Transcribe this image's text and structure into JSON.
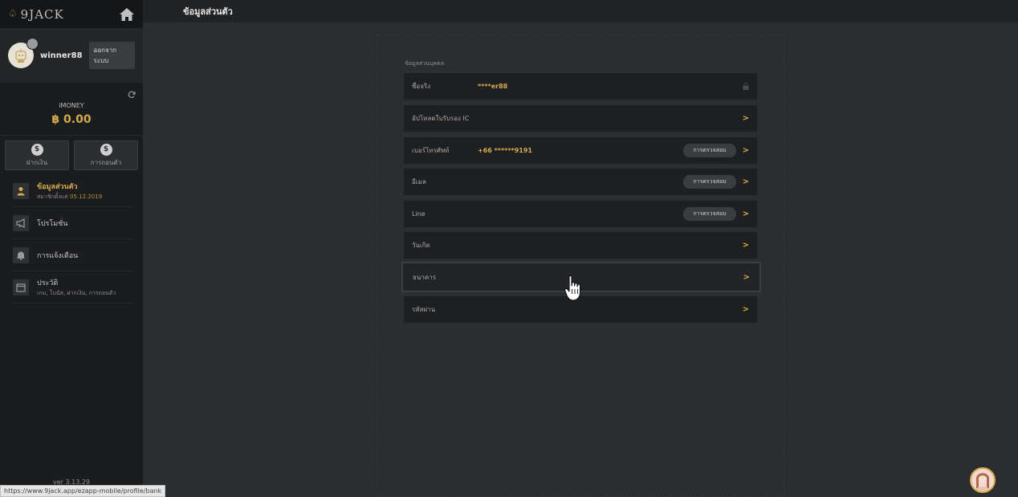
{
  "sidebar": {
    "logo_text": "9JACK",
    "username": "winner88",
    "logout_label": "ออกจากระบบ",
    "wallet_label": "iMONEY",
    "balance": "฿ 0.00",
    "deposit_label": "ฝากเงิน",
    "withdraw_label": "การถอนตัว",
    "items": [
      {
        "title": "ข้อมูลส่วนตัว",
        "sub_prefix": "สมาชิกตั้งแต่ ",
        "sub_date": "05.12.2019",
        "icon": "user-icon"
      },
      {
        "title": "โปรโมชั่น",
        "icon": "megaphone-icon"
      },
      {
        "title": "การแจ้งเตือน",
        "icon": "bell-icon"
      },
      {
        "title": "ประวัติ",
        "sub": "เกม, โบนัส, ฝากเงิน, การถอนตัว",
        "icon": "calendar-icon"
      }
    ],
    "version": "ver 3.13.29"
  },
  "header": {
    "title": "ข้อมูลส่วนตัว"
  },
  "profile": {
    "section_title": "ข้อมูลส่วนบุคคล",
    "rows": [
      {
        "label": "ชื่อจริง",
        "value": "****er88"
      },
      {
        "label": "อัปโหลดใบรับรอง IC"
      },
      {
        "label": "เบอร์โทรศัพท์",
        "value": "+66 ******9191",
        "action": "การตรวจสอบ"
      },
      {
        "label": "อีเมล",
        "action": "การตรวจสอบ"
      },
      {
        "label": "Line",
        "action": "การตรวจสอบ"
      },
      {
        "label": "วันเกิด"
      },
      {
        "label": "ธนาคาร"
      },
      {
        "label": "รหัสผ่าน"
      }
    ]
  },
  "status_bar": {
    "url": "https://www.9jack.app/ezapp-mobile/profile/bank"
  },
  "colors": {
    "accent": "#d6aa4e",
    "sidebar_bg": "#1b1c1e",
    "page_bg": "#2b2e31",
    "row_bg": "#1e1f21"
  }
}
